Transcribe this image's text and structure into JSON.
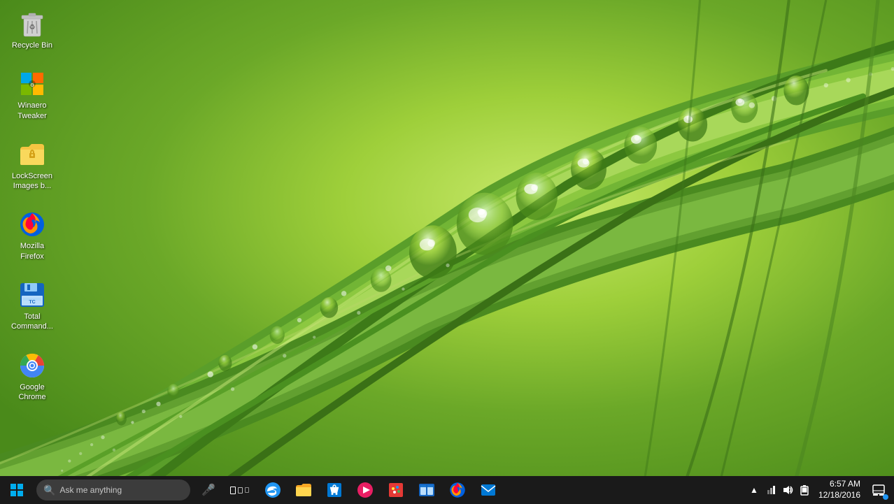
{
  "desktop": {
    "icons": [
      {
        "id": "recycle-bin",
        "label": "Recycle Bin",
        "type": "recycle"
      },
      {
        "id": "winaero-tweaker",
        "label": "Winaero Tweaker",
        "type": "winaero"
      },
      {
        "id": "lockscreen-images",
        "label": "LockScreen Images b...",
        "type": "folder"
      },
      {
        "id": "mozilla-firefox",
        "label": "Mozilla Firefox",
        "type": "firefox"
      },
      {
        "id": "total-commander",
        "label": "Total Command...",
        "type": "totalcmd"
      },
      {
        "id": "google-chrome",
        "label": "Google Chrome",
        "type": "chrome"
      }
    ]
  },
  "taskbar": {
    "search_placeholder": "Ask me anything",
    "time": "6:57 AM",
    "date": "12/18/2016",
    "pinned_apps": [
      "edge",
      "file-explorer",
      "store",
      "media",
      "paint",
      "commander",
      "firefox",
      "mail"
    ]
  }
}
